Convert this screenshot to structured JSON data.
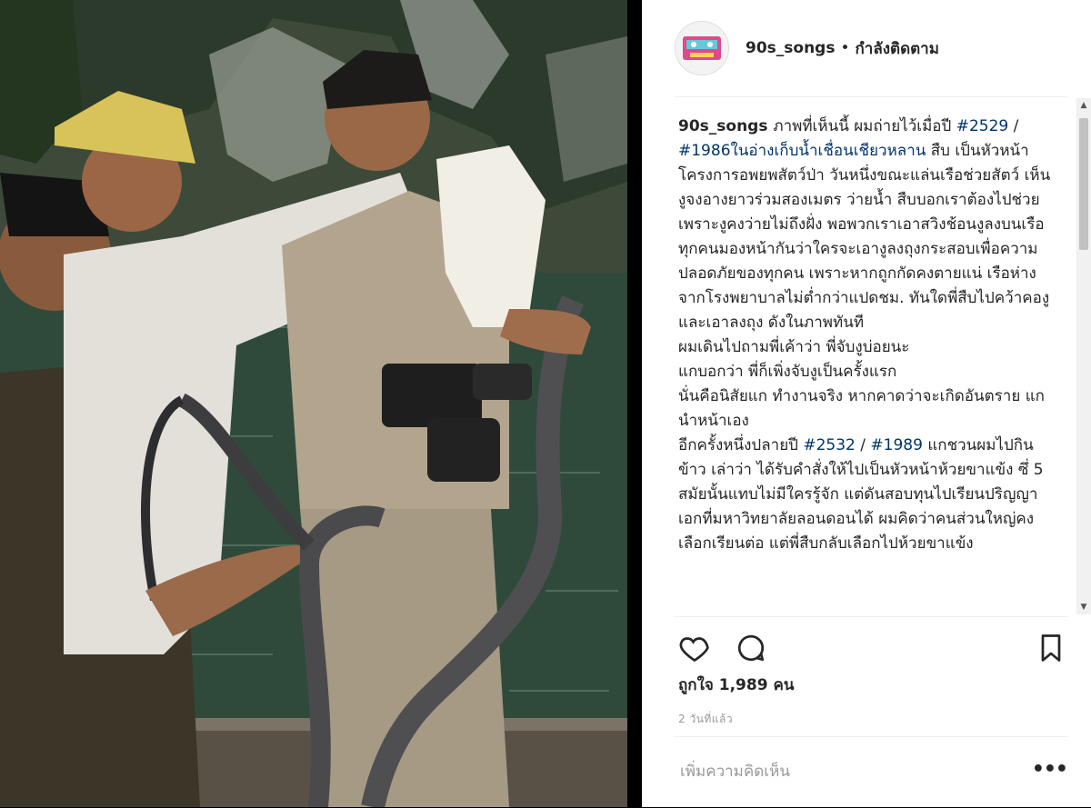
{
  "post": {
    "username": "90s_songs",
    "dot": "•",
    "follow_status": "กำลังติดตาม",
    "caption_username": "90s_songs",
    "caption_lines": [
      [
        {
          "t": "ภาพที่เห็นนี้ ผมถ่ายไว้เมื่อปี ",
          "tag": false
        },
        {
          "t": "#2529",
          "tag": true
        },
        {
          "t": " / ",
          "tag": false
        },
        {
          "t": "#1986ในอ่างเก็บน้ำเชื่อนเชียวหลาน",
          "tag": true
        },
        {
          "t": " สืบ เป็นหัวหน้าโครงการอพยพสัตว์ป่า วันหนึ่งขณะแล่นเรือช่วยสัตว์ เห็นงูจงอางยาวร่วมสองเมตร ว่ายน้ำ สืบบอกเราต้องไปช่วย เพราะงูคงว่ายไม่ถึงฝั่ง พอพวกเราเอาสวิงช้อนงูลงบนเรือ ทุกคนมองหน้ากันว่าใครจะเอางูลงถุงกระสอบเพื่อความปลอดภัยของทุกคน เพราะหากถูกกัดคงตายแน่ เรือห่างจากโรงพยาบาลไม่ต่ำกว่าแปดชม. ทันใดพี่สืบไปคว้าคองูและเอาลงถุง ดังในภาพทันที",
          "tag": false
        }
      ],
      [
        {
          "t": "ผมเดินไปถามพี่เค้าว่า พี่จับงูบ่อยนะ",
          "tag": false
        }
      ],
      [
        {
          "t": "แกบอกว่า พี่ก็เพิ่งจับงูเป็นครั้งแรก",
          "tag": false
        }
      ],
      [
        {
          "t": "นั่นคือนิสัยแก ทำงานจริง หากคาดว่าจะเกิดอันตราย แกนำหน้าเอง",
          "tag": false
        }
      ],
      [
        {
          "t": "อีกครั้งหนึ่งปลายปี ",
          "tag": false
        },
        {
          "t": "#2532",
          "tag": true
        },
        {
          "t": " / ",
          "tag": false
        },
        {
          "t": "#1989",
          "tag": true
        },
        {
          "t": " แกชวนผมไปกินข้าว เล่าว่า ได้รับคำสั่งให้ไปเป็นหัวหน้าห้วยขาแข้ง ซึ่ 5 สมัยนั้นแทบไม่มีใครรู้จัก แต่ดันสอบทุนไปเรียนปริญญาเอกที่มหาวิทยาลัยลอนดอนได้ ผมคิดว่าคนส่วนใหญ่คงเลือกเรียนต่อ แต่พี่สืบกลับเลือกไปห้วยขาแข้ง",
          "tag": false
        }
      ]
    ],
    "likes_text": "ถูกใจ 1,989 คน",
    "time_ago": "2 วันที่แล้ว",
    "comment_placeholder": "เพิ่มความคิดเห็น",
    "more_label": "•••",
    "icons": {
      "like": "heart-icon",
      "comment": "comment-icon",
      "save": "bookmark-icon"
    }
  },
  "scrollbar": {
    "up": "▲",
    "down": "▼"
  }
}
